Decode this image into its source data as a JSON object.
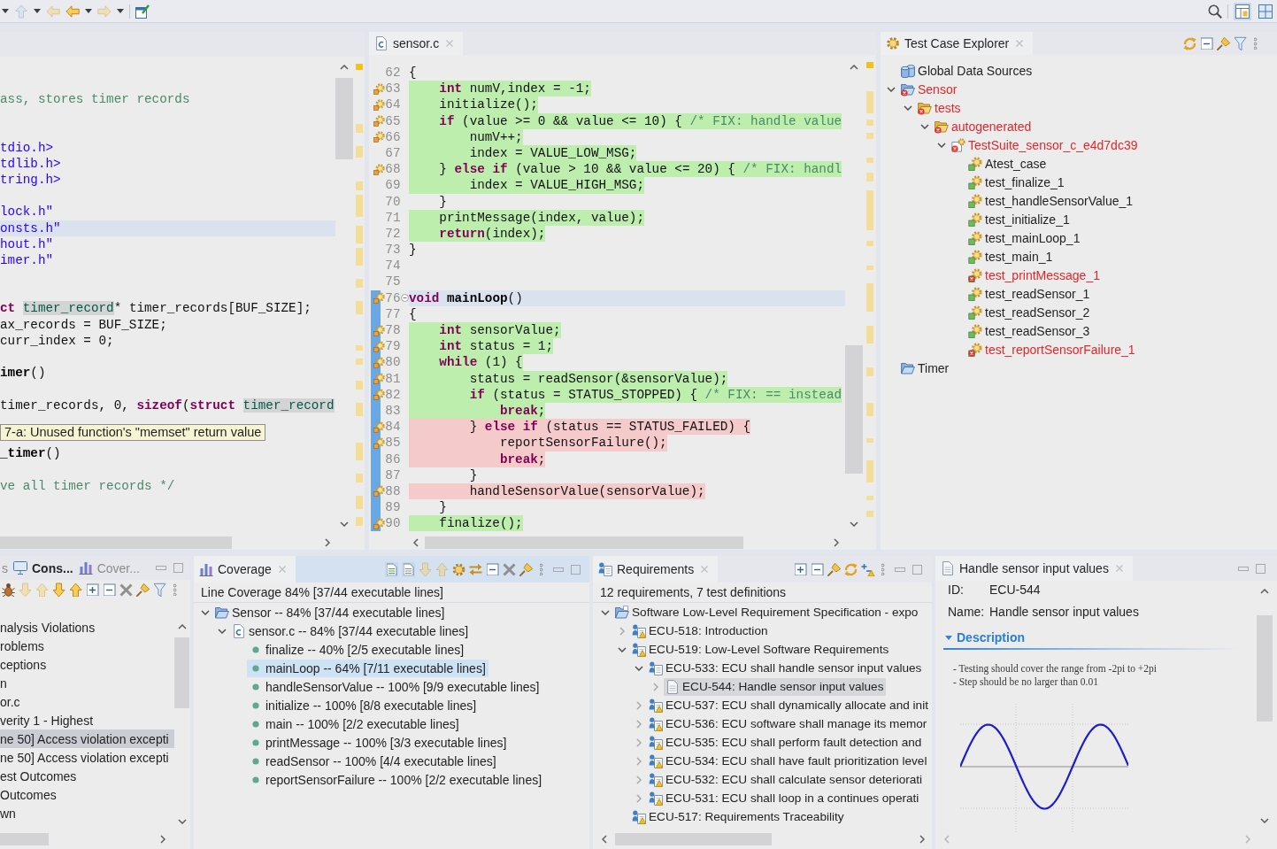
{
  "toolbar": {
    "buttons": [
      {
        "kind": "dropdown",
        "disabled": true
      },
      {
        "kind": "plain",
        "disabled": true
      },
      {
        "kind": "dropdown",
        "disabled": false
      },
      {
        "kind": "dropdown",
        "disabled": true
      },
      {
        "kind": "plain",
        "disabled": false
      }
    ],
    "perspectives": [
      {
        "selected": true
      },
      {
        "selected": false
      }
    ]
  },
  "left_editor": {
    "active": false,
    "tooltip": "7-a: Unused function's \"memset\" return value",
    "lines": [
      {
        "current": false,
        "tokens": [
          {
            "kind": "comment",
            "text": "ass, stores timer records"
          }
        ]
      },
      {
        "current": false
      },
      {
        "current": false
      },
      {
        "current": false,
        "tokens": [
          {
            "kind": "string",
            "text": "tdio.h>"
          }
        ]
      },
      {
        "current": false,
        "tokens": [
          {
            "kind": "string",
            "text": "tdlib.h>"
          }
        ]
      },
      {
        "current": false,
        "tokens": [
          {
            "kind": "string",
            "text": "tring.h>"
          }
        ]
      },
      {
        "current": false
      },
      {
        "current": false,
        "tokens": [
          {
            "kind": "string",
            "text": "lock.h\""
          }
        ]
      },
      {
        "current": true,
        "tokens": [
          {
            "kind": "string",
            "text": "onsts.h\""
          }
        ]
      },
      {
        "current": false,
        "tokens": [
          {
            "kind": "string",
            "text": "hout.h\""
          }
        ]
      },
      {
        "current": false,
        "tokens": [
          {
            "kind": "string",
            "text": "imer.h\""
          }
        ]
      },
      {
        "current": false
      },
      {
        "current": false
      },
      {
        "current": false,
        "tokens": [
          {
            "kind": "keyword",
            "text": "ct "
          },
          {
            "kind": "type",
            "text": "timer_record"
          },
          {
            "kind": "plain",
            "text": "* timer_records[BUF_SIZE];"
          }
        ]
      },
      {
        "current": false,
        "tokens": [
          {
            "kind": "plain",
            "text": "ax_records = BUF_SIZE;"
          }
        ]
      },
      {
        "current": false,
        "tokens": [
          {
            "kind": "plain",
            "text": "curr_index = 0;"
          }
        ]
      },
      {
        "current": false
      },
      {
        "current": false,
        "tokens": [
          {
            "kind": "function",
            "text": "imer"
          },
          {
            "kind": "plain",
            "text": "()"
          }
        ]
      },
      {
        "current": false
      },
      {
        "current": false,
        "tokens": [
          {
            "kind": "plain",
            "text": "timer_records, 0, "
          },
          {
            "kind": "keyword",
            "text": "sizeof"
          },
          {
            "kind": "plain",
            "text": "("
          },
          {
            "kind": "keyword",
            "text": "struct "
          },
          {
            "kind": "type",
            "text": "timer_record"
          }
        ]
      },
      {
        "current": false
      },
      {
        "current": false
      },
      {
        "current": false,
        "tokens": [
          {
            "kind": "function",
            "text": "_timer"
          },
          {
            "kind": "plain",
            "text": "()"
          }
        ]
      },
      {
        "current": false
      },
      {
        "current": false,
        "tokens": [
          {
            "kind": "comment",
            "text": "ve all timer records */"
          }
        ]
      }
    ]
  },
  "editor": {
    "active": false,
    "tabs": [
      {
        "label": "sensor.c",
        "selected": true
      }
    ],
    "lines": [
      {
        "number": "62",
        "marker": false,
        "range": false,
        "fold": false,
        "current": false,
        "covered": false,
        "missed": false,
        "tokens": [
          {
            "kind": "plain",
            "text": "{"
          }
        ]
      },
      {
        "number": "63",
        "marker": true,
        "range": false,
        "fold": false,
        "current": false,
        "covered": true,
        "missed": false,
        "tokens": [
          {
            "kind": "keyword",
            "text": "    int"
          },
          {
            "kind": "plain",
            "text": " numV,index = -1;"
          }
        ]
      },
      {
        "number": "64",
        "marker": true,
        "range": false,
        "fold": false,
        "current": false,
        "covered": true,
        "missed": false,
        "tokens": [
          {
            "kind": "plain",
            "text": "    initialize();"
          }
        ]
      },
      {
        "number": "65",
        "marker": true,
        "range": false,
        "fold": false,
        "current": false,
        "covered": true,
        "missed": false,
        "tokens": [
          {
            "kind": "keyword",
            "text": "    if"
          },
          {
            "kind": "plain",
            "text": " (value >= 0 && value <= 10) { "
          },
          {
            "kind": "comment",
            "text": "/* FIX: handle value"
          }
        ]
      },
      {
        "number": "66",
        "marker": true,
        "range": false,
        "fold": false,
        "current": false,
        "covered": true,
        "missed": false,
        "tokens": [
          {
            "kind": "plain",
            "text": "        numV++;"
          }
        ]
      },
      {
        "number": "67",
        "marker": false,
        "range": false,
        "fold": false,
        "current": false,
        "covered": true,
        "missed": false,
        "tokens": [
          {
            "kind": "plain",
            "text": "        index = VALUE_LOW_MSG;"
          }
        ]
      },
      {
        "number": "68",
        "marker": true,
        "range": false,
        "fold": false,
        "current": false,
        "covered": true,
        "missed": false,
        "tokens": [
          {
            "kind": "plain",
            "text": "    } "
          },
          {
            "kind": "keyword",
            "text": "else if"
          },
          {
            "kind": "plain",
            "text": " (value > 10 && value <= 20) { "
          },
          {
            "kind": "comment",
            "text": "/* FIX: handl"
          }
        ]
      },
      {
        "number": "69",
        "marker": false,
        "range": false,
        "fold": false,
        "current": false,
        "covered": true,
        "missed": false,
        "tokens": [
          {
            "kind": "plain",
            "text": "        index = VALUE_HIGH_MSG;"
          }
        ]
      },
      {
        "number": "70",
        "marker": false,
        "range": false,
        "fold": false,
        "current": false,
        "covered": false,
        "missed": false,
        "tokens": [
          {
            "kind": "plain",
            "text": "    }"
          }
        ]
      },
      {
        "number": "71",
        "marker": false,
        "range": false,
        "fold": false,
        "current": false,
        "covered": true,
        "missed": false,
        "tokens": [
          {
            "kind": "plain",
            "text": "    printMessage(index, value);"
          }
        ]
      },
      {
        "number": "72",
        "marker": false,
        "range": false,
        "fold": false,
        "current": false,
        "covered": true,
        "missed": false,
        "tokens": [
          {
            "kind": "keyword",
            "text": "    return"
          },
          {
            "kind": "plain",
            "text": "(index);"
          }
        ]
      },
      {
        "number": "73",
        "marker": false,
        "range": false,
        "fold": false,
        "current": false,
        "covered": false,
        "missed": false,
        "tokens": [
          {
            "kind": "plain",
            "text": "}"
          }
        ]
      },
      {
        "number": "74",
        "marker": false,
        "range": false,
        "fold": false,
        "current": false
      },
      {
        "number": "75",
        "marker": false,
        "range": false,
        "fold": false,
        "current": false
      },
      {
        "number": "76",
        "marker": true,
        "range": true,
        "fold": true,
        "current": true,
        "covered": false,
        "missed": false,
        "tokens": [
          {
            "kind": "keyword",
            "text": "void "
          },
          {
            "kind": "function",
            "text": "mainLoop"
          },
          {
            "kind": "plain",
            "text": "()"
          }
        ]
      },
      {
        "number": "77",
        "marker": false,
        "range": true,
        "fold": false,
        "current": false,
        "covered": false,
        "missed": false,
        "tokens": [
          {
            "kind": "plain",
            "text": "{"
          }
        ]
      },
      {
        "number": "78",
        "marker": true,
        "range": true,
        "fold": false,
        "current": false,
        "covered": true,
        "missed": false,
        "tokens": [
          {
            "kind": "keyword",
            "text": "    int"
          },
          {
            "kind": "plain",
            "text": " sensorValue;"
          }
        ]
      },
      {
        "number": "79",
        "marker": true,
        "range": true,
        "fold": false,
        "current": false,
        "covered": true,
        "missed": false,
        "tokens": [
          {
            "kind": "keyword",
            "text": "    int"
          },
          {
            "kind": "plain",
            "text": " status = 1;"
          }
        ]
      },
      {
        "number": "80",
        "marker": true,
        "range": true,
        "fold": false,
        "current": false,
        "covered": true,
        "missed": false,
        "tokens": [
          {
            "kind": "keyword",
            "text": "    while"
          },
          {
            "kind": "plain",
            "text": " (1) {"
          }
        ]
      },
      {
        "number": "81",
        "marker": true,
        "range": true,
        "fold": false,
        "current": false,
        "covered": true,
        "missed": false,
        "tokens": [
          {
            "kind": "plain",
            "text": "        status = readSensor(&sensorValue);"
          }
        ]
      },
      {
        "number": "82",
        "marker": true,
        "range": true,
        "fold": false,
        "current": false,
        "covered": true,
        "missed": false,
        "tokens": [
          {
            "kind": "keyword",
            "text": "        if"
          },
          {
            "kind": "plain",
            "text": " (status = STATUS_STOPPED) { "
          },
          {
            "kind": "comment",
            "text": "/* FIX: == instead"
          }
        ]
      },
      {
        "number": "83",
        "marker": false,
        "range": true,
        "fold": false,
        "current": false,
        "covered": true,
        "missed": false,
        "tokens": [
          {
            "kind": "keyword",
            "text": "            break"
          },
          {
            "kind": "plain",
            "text": ";"
          }
        ]
      },
      {
        "number": "84",
        "marker": true,
        "range": true,
        "fold": false,
        "current": false,
        "covered": false,
        "missed": true,
        "tokens": [
          {
            "kind": "plain",
            "text": "        } "
          },
          {
            "kind": "keyword",
            "text": "else if"
          },
          {
            "kind": "plain",
            "text": " (status == STATUS_FAILED) {"
          }
        ]
      },
      {
        "number": "85",
        "marker": true,
        "range": true,
        "fold": false,
        "current": false,
        "covered": false,
        "missed": true,
        "tokens": [
          {
            "kind": "plain",
            "text": "            reportSensorFailure();"
          }
        ]
      },
      {
        "number": "86",
        "marker": false,
        "range": true,
        "fold": false,
        "current": false,
        "covered": false,
        "missed": true,
        "tokens": [
          {
            "kind": "keyword",
            "text": "            break"
          },
          {
            "kind": "plain",
            "text": ";"
          }
        ]
      },
      {
        "number": "87",
        "marker": false,
        "range": true,
        "fold": false,
        "current": false,
        "covered": false,
        "missed": false,
        "tokens": [
          {
            "kind": "plain",
            "text": "        }"
          }
        ]
      },
      {
        "number": "88",
        "marker": true,
        "range": true,
        "fold": false,
        "current": false,
        "covered": false,
        "missed": true,
        "tokens": [
          {
            "kind": "plain",
            "text": "        handleSensorValue(sensorValue);"
          }
        ]
      },
      {
        "number": "89",
        "marker": false,
        "range": true,
        "fold": false,
        "current": false,
        "covered": false,
        "missed": false,
        "tokens": [
          {
            "kind": "plain",
            "text": "    }"
          }
        ]
      },
      {
        "number": "90",
        "marker": true,
        "range": true,
        "fold": false,
        "current": false,
        "covered": true,
        "missed": false,
        "tokens": [
          {
            "kind": "plain",
            "text": "    finalize();"
          }
        ]
      }
    ]
  },
  "test_case_explorer": {
    "active": false,
    "tabs": [
      {
        "label": "Test Case Explorer",
        "selected": true
      }
    ],
    "tree": [
      {
        "label": "Global Data Sources",
        "kind": "data",
        "failed": false,
        "selected": false
      },
      {
        "label": "Sensor",
        "kind": "project",
        "failed": true,
        "expanded": true,
        "selected": false,
        "children": [
          {
            "label": "tests",
            "kind": "folder",
            "failed": true,
            "expanded": true,
            "selected": false,
            "children": [
              {
                "label": "autogenerated",
                "kind": "folder",
                "failed": true,
                "expanded": true,
                "selected": false,
                "children": [
                  {
                    "label": "TestSuite_sensor_c_e4d7dc39",
                    "kind": "suite",
                    "failed": true,
                    "expanded": true,
                    "selected": false,
                    "children": [
                      {
                        "label": "Atest_case",
                        "kind": "test",
                        "failed": false,
                        "selected": false
                      },
                      {
                        "label": "test_finalize_1",
                        "kind": "test",
                        "failed": false,
                        "selected": false
                      },
                      {
                        "label": "test_handleSensorValue_1",
                        "kind": "test",
                        "failed": false,
                        "selected": false
                      },
                      {
                        "label": "test_initialize_1",
                        "kind": "test",
                        "failed": false,
                        "selected": false
                      },
                      {
                        "label": "test_mainLoop_1",
                        "kind": "test",
                        "failed": false,
                        "selected": false
                      },
                      {
                        "label": "test_main_1",
                        "kind": "test",
                        "failed": false,
                        "selected": false
                      },
                      {
                        "label": "test_printMessage_1",
                        "kind": "test",
                        "failed": true,
                        "selected": false
                      },
                      {
                        "label": "test_readSensor_1",
                        "kind": "test",
                        "failed": false,
                        "selected": false
                      },
                      {
                        "label": "test_readSensor_2",
                        "kind": "test",
                        "failed": false,
                        "selected": false
                      },
                      {
                        "label": "test_readSensor_3",
                        "kind": "test",
                        "failed": false,
                        "selected": false
                      },
                      {
                        "label": "test_reportSensorFailure_1",
                        "kind": "test",
                        "failed": true,
                        "selected": false
                      }
                    ]
                  }
                ]
              }
            ]
          }
        ]
      },
      {
        "label": "Timer",
        "kind": "project",
        "failed": false,
        "selected": false
      }
    ]
  },
  "results_panel": {
    "active": false,
    "tabs": [
      {
        "label": "s",
        "selected": false,
        "highlighted": false
      },
      {
        "label": "Cons...",
        "selected": false,
        "highlighted": true
      },
      {
        "label": "Cover...",
        "selected": false,
        "highlighted": false
      }
    ],
    "toolbar": [
      {
        "disabled": false
      },
      {
        "disabled": true
      },
      {
        "disabled": true
      },
      {
        "disabled": false
      },
      {
        "disabled": false
      },
      {
        "disabled": false
      },
      {
        "disabled": false
      },
      {
        "disabled": false
      },
      {
        "disabled": false
      },
      {
        "disabled": false
      },
      {
        "disabled": false
      }
    ],
    "items": [
      {
        "label": "nalysis Violations",
        "selected": false
      },
      {
        "label": "roblems",
        "selected": false
      },
      {
        "label": "ceptions",
        "selected": false
      },
      {
        "label": "n",
        "selected": false
      },
      {
        "label": "or.c",
        "selected": false
      },
      {
        "label": "verity 1 - Highest",
        "selected": false
      },
      {
        "label": "ne 50] Access violation excepti",
        "selected": true
      },
      {
        "label": "ne 50] Access violation excepti",
        "selected": false
      },
      {
        "label": "est Outcomes",
        "selected": false
      },
      {
        "label": "Outcomes",
        "selected": false
      },
      {
        "label": "wn",
        "selected": false
      }
    ]
  },
  "coverage": {
    "active": true,
    "tabs": [
      {
        "label": "Coverage",
        "selected": true
      }
    ],
    "toolbar": [
      {
        "on": true,
        "disabled": false
      },
      {
        "on": true,
        "disabled": false
      },
      {
        "disabled": true
      },
      {
        "disabled": true
      },
      {
        "disabled": false
      },
      {
        "disabled": false
      },
      {
        "disabled": false
      },
      {
        "disabled": false
      },
      {
        "disabled": false
      },
      {
        "disabled": false
      }
    ],
    "summary": "Line Coverage 84% [37/44 executable lines]",
    "tree": [
      {
        "label": "Sensor -- 84% [37/44 executable lines]",
        "kind": "project",
        "expanded": true,
        "selected": false,
        "children": [
          {
            "label": "sensor.c -- 84% [37/44 executable lines]",
            "kind": "file",
            "expanded": true,
            "selected": false,
            "children": [
              {
                "label": "finalize -- 40% [2/5 executable lines]",
                "kind": "function",
                "selected": false
              },
              {
                "label": "mainLoop -- 64% [7/11 executable lines]",
                "kind": "function",
                "selected": true
              },
              {
                "label": "handleSensorValue -- 100% [9/9 executable lines]",
                "kind": "function",
                "selected": false
              },
              {
                "label": "initialize -- 100% [8/8 executable lines]",
                "kind": "function",
                "selected": false
              },
              {
                "label": "main -- 100% [2/2 executable lines]",
                "kind": "function",
                "selected": false
              },
              {
                "label": "printMessage -- 100% [3/3 executable lines]",
                "kind": "function",
                "selected": false
              },
              {
                "label": "readSensor -- 100% [4/4 executable lines]",
                "kind": "function",
                "selected": false
              },
              {
                "label": "reportSensorFailure -- 100% [2/2 executable lines]",
                "kind": "function",
                "selected": false
              }
            ]
          }
        ]
      }
    ]
  },
  "requirements": {
    "active": false,
    "tabs": [
      {
        "label": "Requirements",
        "selected": true
      }
    ],
    "summary": "12 requirements, 7 test definitions",
    "tree": [
      {
        "label": "Software Low-Level Requirement Specification - expo",
        "kind": "specification",
        "warning": false,
        "expanded": true,
        "selected": false,
        "children": [
          {
            "label": "ECU-518: Introduction",
            "kind": "requirement",
            "warning": true,
            "expanded": false,
            "selected": false
          },
          {
            "label": "ECU-519: Low-Level Software Requirements",
            "kind": "requirement",
            "warning": true,
            "expanded": true,
            "selected": false,
            "children": [
              {
                "label": "ECU-533: ECU shall handle sensor input values",
                "kind": "requirement",
                "warning": false,
                "expanded": true,
                "selected": false,
                "children": [
                  {
                    "label": "ECU-544: Handle sensor input values",
                    "kind": "document",
                    "warning": false,
                    "expanded": false,
                    "selected": true
                  }
                ]
              },
              {
                "label": "ECU-537: ECU shall dynamically allocate and init",
                "kind": "requirement",
                "warning": true,
                "expanded": false,
                "selected": false
              },
              {
                "label": "ECU-536: ECU software shall manage its memor",
                "kind": "requirement",
                "warning": true,
                "expanded": false,
                "selected": false
              },
              {
                "label": "ECU-535: ECU shall perform fault detection and",
                "kind": "requirement",
                "warning": true,
                "expanded": false,
                "selected": false
              },
              {
                "label": "ECU-534: ECU shall have fault prioritization level",
                "kind": "requirement",
                "warning": true,
                "expanded": false,
                "selected": false
              },
              {
                "label": "ECU-532: ECU shall calculate sensor deteriorati",
                "kind": "requirement",
                "warning": true,
                "expanded": false,
                "selected": false
              },
              {
                "label": "ECU-531: ECU shall loop in a continues operati",
                "kind": "requirement",
                "warning": true,
                "expanded": false,
                "selected": false
              }
            ]
          },
          {
            "label": "ECU-517: Requirements Traceability",
            "kind": "requirement",
            "warning": true,
            "selected": false
          }
        ]
      }
    ]
  },
  "requirement_details": {
    "active": false,
    "tabs": [
      {
        "label": "Handle sensor input values",
        "selected": true
      }
    ],
    "fields": [
      {
        "label": "ID:",
        "value": "ECU-544"
      },
      {
        "label": "Name:",
        "value": "Handle sensor input values"
      }
    ],
    "section": {
      "title": "Description",
      "expanded": true,
      "lines": [
        "- Testing should cover the range from -2pi to +2pi",
        "- Step should be no larger than 0.01"
      ]
    }
  }
}
